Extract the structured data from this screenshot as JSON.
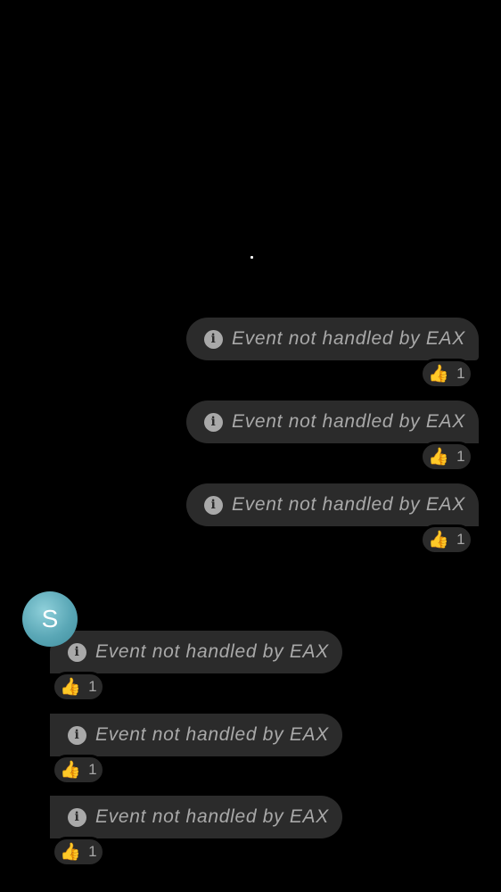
{
  "chat": {
    "avatar_letter": "S",
    "messages": [
      {
        "text": "Event not handled by EAX",
        "reaction_emoji": "👍",
        "reaction_count": "1"
      },
      {
        "text": "Event not handled by EAX",
        "reaction_emoji": "👍",
        "reaction_count": "1"
      },
      {
        "text": "Event not handled by EAX",
        "reaction_emoji": "👍",
        "reaction_count": "1"
      },
      {
        "text": "Event not handled by EAX",
        "reaction_emoji": "👍",
        "reaction_count": "1"
      },
      {
        "text": "Event not handled by EAX",
        "reaction_emoji": "👍",
        "reaction_count": "1"
      },
      {
        "text": "Event not handled by EAX",
        "reaction_emoji": "👍",
        "reaction_count": "1"
      }
    ]
  },
  "colors": {
    "background": "#000000",
    "bubble": "#2b2b2b",
    "text": "#a9a9a9",
    "reaction_emoji": "#f5b820",
    "avatar": "#5aa7b6"
  },
  "icons": {
    "info": "info-circle-icon",
    "loading": "loading-dot"
  }
}
